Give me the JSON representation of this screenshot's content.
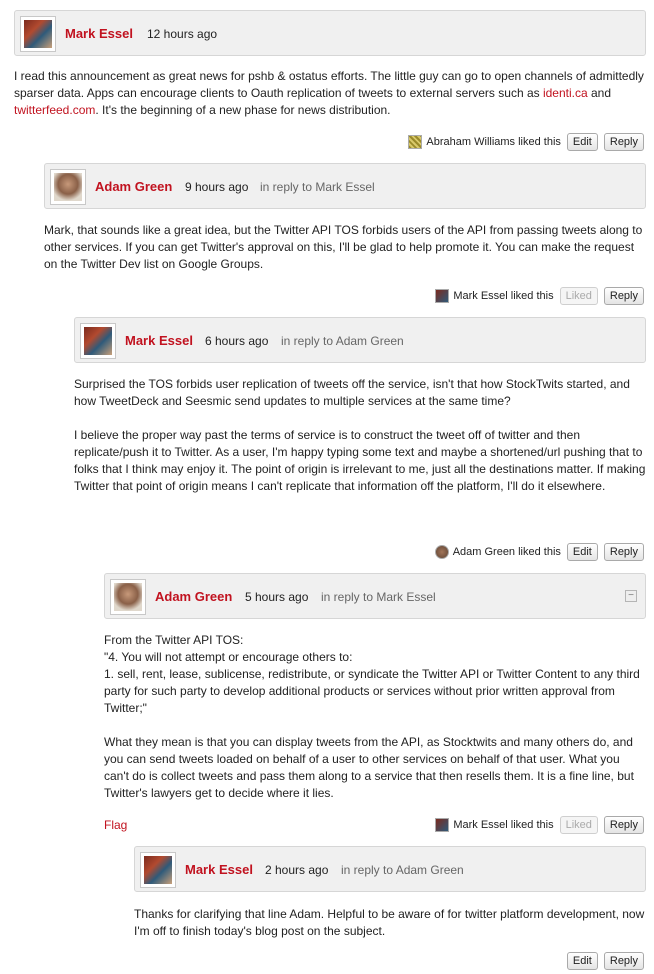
{
  "comments": [
    {
      "author": "Mark Essel",
      "time": "12 hours ago",
      "body_parts": {
        "before_link1": "I read this announcement as great news for pshb & ostatus efforts. The little guy can go to open channels of admittedly sparser data. Apps can encourage clients to Oauth replication of tweets to external servers such as ",
        "link1": "identi.ca",
        "between": " and ",
        "link2": "twitterfeed.com",
        "after": ". It's the beginning of a new phase for news distribution."
      },
      "liked_by": "Abraham Williams liked this",
      "buttons": {
        "edit": "Edit",
        "reply": "Reply"
      }
    },
    {
      "author": "Adam Green",
      "time": "9 hours ago",
      "in_reply_to": "in reply to Mark Essel",
      "body": "Mark, that sounds like a great idea, but the Twitter API TOS forbids users of the API from passing tweets along to other services. If you can get Twitter's approval on this, I'll be glad to help promote it. You can make the request on the Twitter Dev list on Google Groups.",
      "liked_by": "Mark Essel liked this",
      "buttons": {
        "liked": "Liked",
        "reply": "Reply"
      }
    },
    {
      "author": "Mark Essel",
      "time": "6 hours ago",
      "in_reply_to": "in reply to Adam Green",
      "body_p1": "Surprised the TOS forbids user replication of tweets off the service, isn't that how StockTwits started, and how TweetDeck and Seesmic send updates to multiple services at the same time?",
      "body_p2": "I believe the proper way past the terms of service is to construct the tweet off of twitter and then replicate/push it to Twitter. As a user, I'm happy typing some text and maybe a shortened/url pushing that to folks that I think may enjoy it. The point of origin is irrelevant to me, just all the destinations matter. If making Twitter that point of origin means I can't replicate that information off the platform, I'll do it elsewhere.",
      "liked_by": "Adam Green liked this",
      "buttons": {
        "edit": "Edit",
        "reply": "Reply"
      }
    },
    {
      "author": "Adam Green",
      "time": "5 hours ago",
      "in_reply_to": "in reply to Mark Essel",
      "collapse": "−",
      "body_l1": "From the Twitter API TOS:",
      "body_l2": "\"4. You will not attempt or encourage others to:",
      "body_l3": "1. sell, rent, lease, sublicense, redistribute, or syndicate the Twitter API or Twitter Content to any third party for such party to develop additional products or services without prior written approval from Twitter;\"",
      "body_p2": "What they mean is that you can display tweets from the API, as Stocktwits and many others do, and you can send tweets loaded on behalf of a user to other services on behalf of that user. What you can't do is collect tweets and pass them along to a service that then resells them. It is a fine line, but Twitter's lawyers get to decide where it lies.",
      "flag": "Flag",
      "liked_by": "Mark Essel liked this",
      "buttons": {
        "liked": "Liked",
        "reply": "Reply"
      }
    },
    {
      "author": "Mark Essel",
      "time": "2 hours ago",
      "in_reply_to": "in reply to Adam Green",
      "body": "Thanks for clarifying that line Adam. Helpful to be aware of for twitter platform development, now I'm off to finish today's blog post on the subject.",
      "buttons": {
        "edit": "Edit",
        "reply": "Reply"
      }
    }
  ]
}
